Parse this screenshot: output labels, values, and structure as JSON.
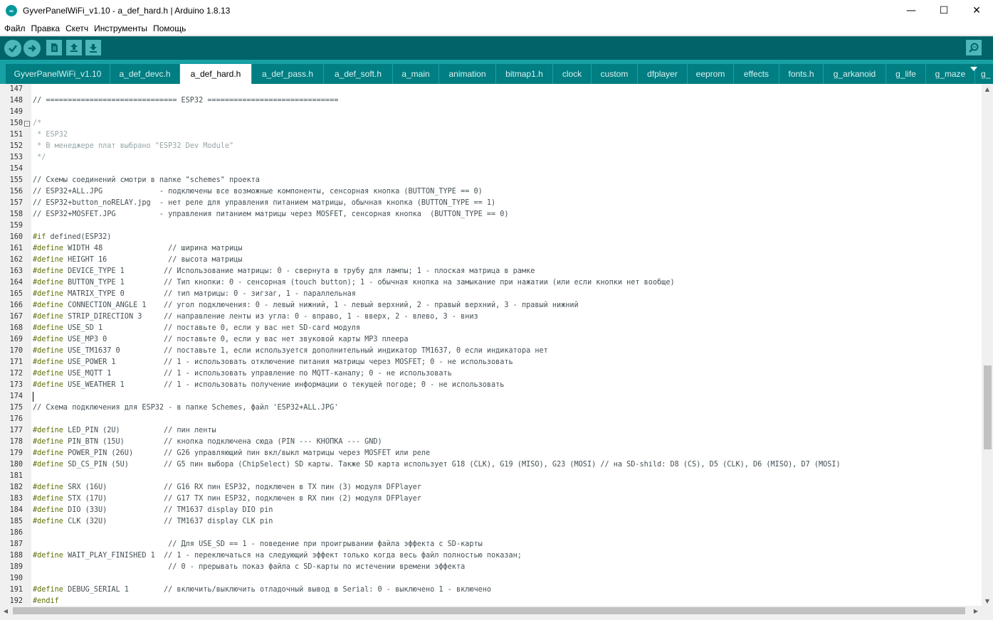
{
  "window": {
    "title": "GyverPanelWiFi_v1.10 - a_def_hard.h | Arduino 1.8.13",
    "app_icon_label": "∞",
    "minimize_glyph": "—",
    "maximize_glyph": "☐",
    "close_glyph": "✕"
  },
  "menu": [
    "Файл",
    "Правка",
    "Скетч",
    "Инструменты",
    "Помощь"
  ],
  "toolbar": {
    "icons": [
      "verify-icon",
      "upload-icon",
      "new-icon",
      "open-icon",
      "save-icon",
      "serial-monitor-icon"
    ]
  },
  "tabs": [
    {
      "label": "GyverPanelWiFi_v1.10",
      "active": false
    },
    {
      "label": "a_def_devc.h",
      "active": false
    },
    {
      "label": "a_def_hard.h",
      "active": true
    },
    {
      "label": "a_def_pass.h",
      "active": false
    },
    {
      "label": "a_def_soft.h",
      "active": false
    },
    {
      "label": "a_main",
      "active": false
    },
    {
      "label": "animation",
      "active": false
    },
    {
      "label": "bitmap1.h",
      "active": false
    },
    {
      "label": "clock",
      "active": false
    },
    {
      "label": "custom",
      "active": false
    },
    {
      "label": "dfplayer",
      "active": false
    },
    {
      "label": "eeprom",
      "active": false
    },
    {
      "label": "effects",
      "active": false
    },
    {
      "label": "fonts.h",
      "active": false
    },
    {
      "label": "g_arkanoid",
      "active": false
    },
    {
      "label": "g_life",
      "active": false
    },
    {
      "label": "g_maze",
      "active": false
    },
    {
      "label": "g_",
      "active": false
    }
  ],
  "colors": {
    "toolbar_bg": "#006468",
    "tabrow_bg": "#17a1a5",
    "tab_inactive": "#007e82",
    "tab_active": "#ffffff",
    "preprocessor": "#5e6d03",
    "comment": "#95a5a6",
    "code_text": "#434f54"
  },
  "editor": {
    "caret_line": 174,
    "fold_marker_line": 150,
    "fold_marker_glyph": "-",
    "lines": [
      {
        "n": 147,
        "t": "",
        "k": "plain"
      },
      {
        "n": 148,
        "t": "// ============================== ESP32 ==============================",
        "k": "plain"
      },
      {
        "n": 149,
        "t": "",
        "k": "plain"
      },
      {
        "n": 150,
        "t": "/*",
        "k": "comment"
      },
      {
        "n": 151,
        "t": " * ESP32",
        "k": "comment"
      },
      {
        "n": 152,
        "t": " * В менеджере плат выбрано \"ESP32 Dev Module\"",
        "k": "comment"
      },
      {
        "n": 153,
        "t": " */",
        "k": "comment"
      },
      {
        "n": 154,
        "t": "",
        "k": "plain"
      },
      {
        "n": 155,
        "t": "// Схемы соединений смотри в папке \"schemes\" проекта",
        "k": "plain"
      },
      {
        "n": 156,
        "t": "// ESP32+ALL.JPG             - подключены все возможные компоненты, сенсорная кнопка (BUTTON_TYPE == 0)",
        "k": "plain"
      },
      {
        "n": 157,
        "t": "// ESP32+button_noRELAY.jpg  - нет реле для управления питанием матрицы, обычная кнопка (BUTTON_TYPE == 1)",
        "k": "plain"
      },
      {
        "n": 158,
        "t": "// ESP32+MOSFET.JPG          - управления питанием матрицы через MOSFET, сенсорная кнопка  (BUTTON_TYPE == 0)",
        "k": "plain"
      },
      {
        "n": 159,
        "t": "",
        "k": "plain"
      },
      {
        "n": 160,
        "p": "#if",
        "t": " defined(ESP32)",
        "k": "pre"
      },
      {
        "n": 161,
        "p": "#define",
        "t": " WIDTH 48               // ширина матрицы",
        "k": "pre"
      },
      {
        "n": 162,
        "p": "#define",
        "t": " HEIGHT 16              // высота матрицы",
        "k": "pre"
      },
      {
        "n": 163,
        "p": "#define",
        "t": " DEVICE_TYPE 1         // Использование матрицы: 0 - свернута в трубу для лампы; 1 - плоская матрица в рамке",
        "k": "pre"
      },
      {
        "n": 164,
        "p": "#define",
        "t": " BUTTON_TYPE 1         // Тип кнопки: 0 - сенсорная (touch button); 1 - обычная кнопка на замыкание при нажатии (или если кнопки нет вообще)",
        "k": "pre"
      },
      {
        "n": 165,
        "p": "#define",
        "t": " MATRIX_TYPE 0         // тип матрицы: 0 - зигзаг, 1 - параллельная",
        "k": "pre"
      },
      {
        "n": 166,
        "p": "#define",
        "t": " CONNECTION_ANGLE 1    // угол подключения: 0 - левый нижний, 1 - левый верхний, 2 - правый верхний, 3 - правый нижний",
        "k": "pre"
      },
      {
        "n": 167,
        "p": "#define",
        "t": " STRIP_DIRECTION 3     // направление ленты из угла: 0 - вправо, 1 - вверх, 2 - влево, 3 - вниз",
        "k": "pre"
      },
      {
        "n": 168,
        "p": "#define",
        "t": " USE_SD 1              // поставьте 0, если у вас нет SD-card модуля",
        "k": "pre"
      },
      {
        "n": 169,
        "p": "#define",
        "t": " USE_MP3 0             // поставьте 0, если у вас нет звуковой карты MP3 плеера",
        "k": "pre"
      },
      {
        "n": 170,
        "p": "#define",
        "t": " USE_TM1637 0          // поставьте 1, если используется дополнительный индикатор TM1637, 0 если индикатора нет",
        "k": "pre"
      },
      {
        "n": 171,
        "p": "#define",
        "t": " USE_POWER 1           // 1 - использовать отключение питания матрицы через MOSFET; 0 - не использовать",
        "k": "pre"
      },
      {
        "n": 172,
        "p": "#define",
        "t": " USE_MQTT 1            // 1 - использовать управление по MQTT-каналу; 0 - не использовать",
        "k": "pre"
      },
      {
        "n": 173,
        "p": "#define",
        "t": " USE_WEATHER 1         // 1 - использовать получение информации о текущей погоде; 0 - не использовать",
        "k": "pre"
      },
      {
        "n": 174,
        "t": "",
        "k": "plain"
      },
      {
        "n": 175,
        "t": "// Схема подключения для ESP32 - в папке Schemes, файл 'ESP32+ALL.JPG'",
        "k": "plain"
      },
      {
        "n": 176,
        "t": "",
        "k": "plain"
      },
      {
        "n": 177,
        "p": "#define",
        "t": " LED_PIN (2U)          // пин ленты",
        "k": "pre"
      },
      {
        "n": 178,
        "p": "#define",
        "t": " PIN_BTN (15U)         // кнопка подключена сюда (PIN --- КНОПКА --- GND)",
        "k": "pre"
      },
      {
        "n": 179,
        "p": "#define",
        "t": " POWER_PIN (26U)       // G26 управляющий пин вкл/выкл матрицы через MOSFET или реле",
        "k": "pre"
      },
      {
        "n": 180,
        "p": "#define",
        "t": " SD_CS_PIN (5U)        // G5 пин выбора (ChipSelect) SD карты. Также SD карта использует G18 (CLK), G19 (MISO), G23 (MOSI) // на SD-shild: D8 (CS), D5 (CLK), D6 (MISO), D7 (MOSI)",
        "k": "pre"
      },
      {
        "n": 181,
        "t": "",
        "k": "plain"
      },
      {
        "n": 182,
        "p": "#define",
        "t": " SRX (16U)             // G16 RX пин ESP32, подключен в TX пин (3) модуля DFPlayer",
        "k": "pre"
      },
      {
        "n": 183,
        "p": "#define",
        "t": " STX (17U)             // G17 TX пин ESP32, подключен в RX пин (2) модуля DFPlayer",
        "k": "pre"
      },
      {
        "n": 184,
        "p": "#define",
        "t": " DIO (33U)             // TM1637 display DIO pin",
        "k": "pre"
      },
      {
        "n": 185,
        "p": "#define",
        "t": " CLK (32U)             // TM1637 display CLK pin",
        "k": "pre"
      },
      {
        "n": 186,
        "t": "",
        "k": "plain"
      },
      {
        "n": 187,
        "t": "                               // Для USE_SD == 1 - поведение при проигрывании файла эффекта с SD-карты",
        "k": "plain"
      },
      {
        "n": 188,
        "p": "#define",
        "t": " WAIT_PLAY_FINISHED 1  // 1 - переключаться на следующий эффект только когда весь файл полностью показан;",
        "k": "pre"
      },
      {
        "n": 189,
        "t": "                               // 0 - прерывать показ файла с SD-карты по истечении времени эффекта",
        "k": "plain"
      },
      {
        "n": 190,
        "t": "",
        "k": "plain"
      },
      {
        "n": 191,
        "p": "#define",
        "t": " DEBUG_SERIAL 1        // включить/выключить отладочный вывод в Serial: 0 - выключено 1 - включено",
        "k": "pre"
      },
      {
        "n": 192,
        "p": "#endif",
        "t": "",
        "k": "pre"
      }
    ]
  },
  "scroll": {
    "up_glyph": "▲",
    "down_glyph": "▼",
    "left_glyph": "◀",
    "right_glyph": "▶"
  }
}
